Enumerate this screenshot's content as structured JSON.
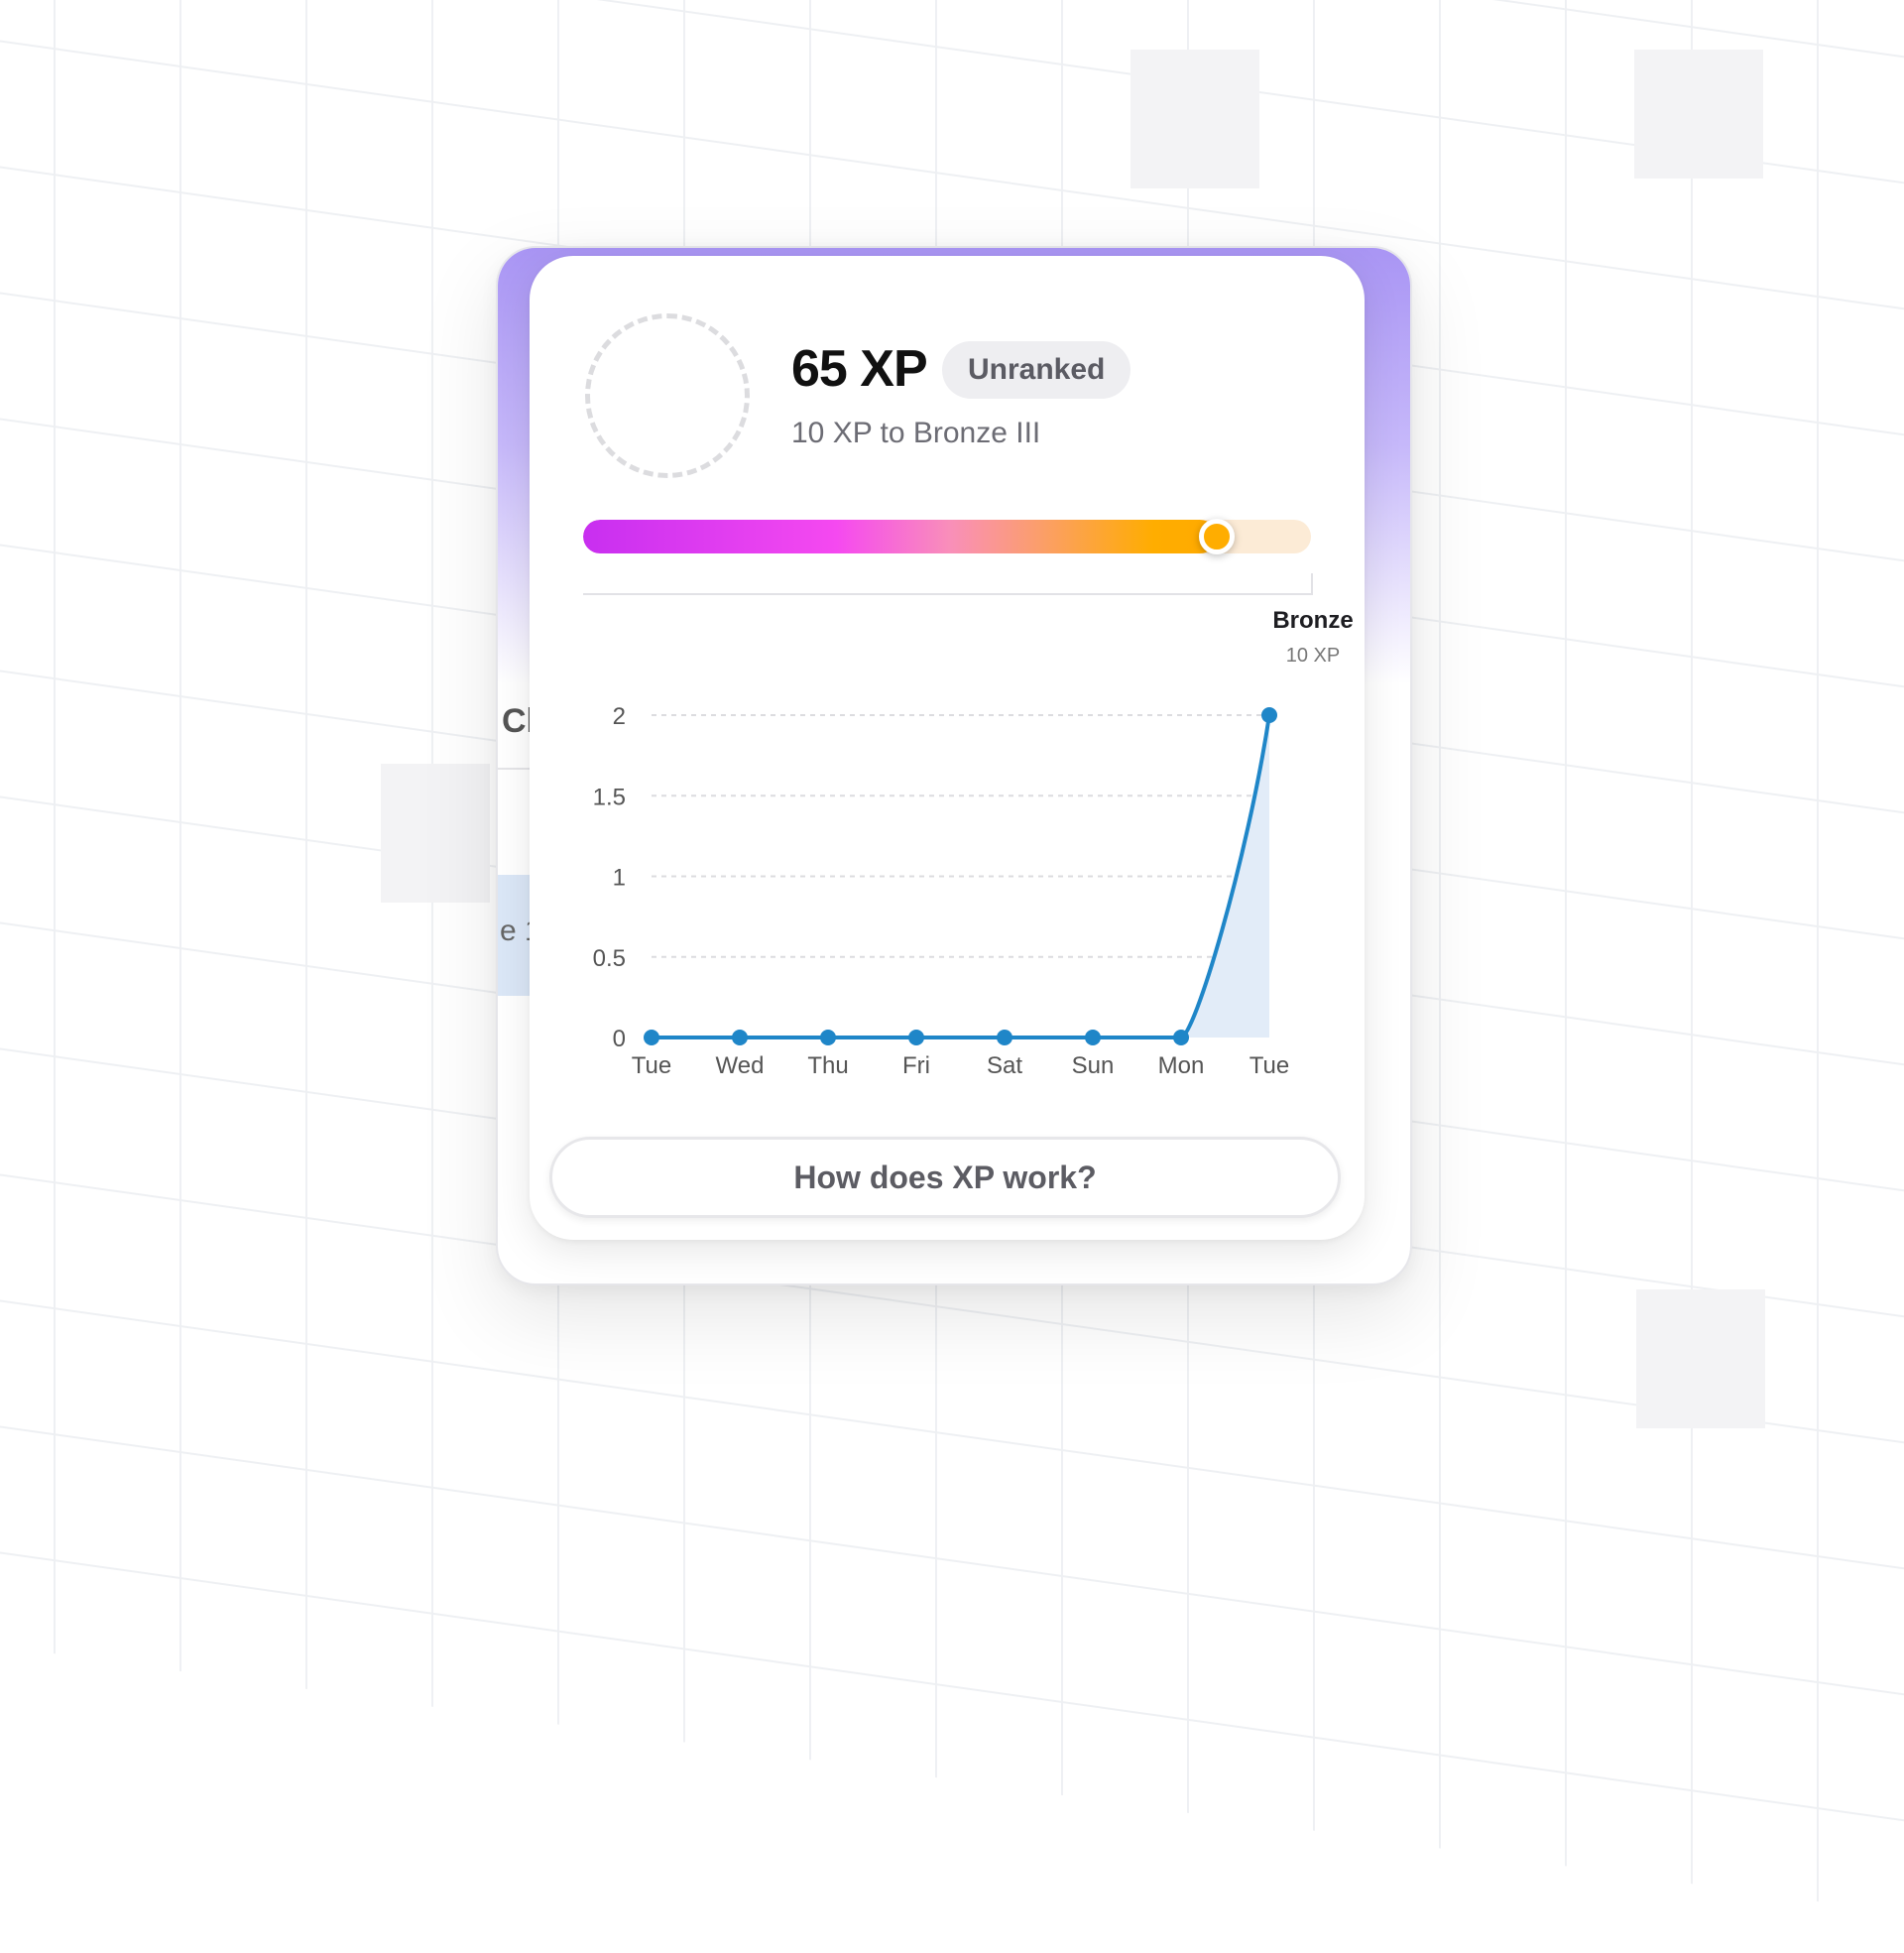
{
  "xp_card": {
    "xp_total": "65 XP",
    "rank_badge": "Unranked",
    "xp_to_next": "10 XP to Bronze III",
    "progress_fraction": 0.87,
    "milestone": {
      "name": "Bronze",
      "xp": "10 XP"
    },
    "help_button_label": "How does XP work?"
  },
  "background_panel": {
    "peek_heading": "Cl",
    "peek_text": "e 1"
  },
  "colors": {
    "accent_purple": "#a995f4",
    "line": "#1f86c8",
    "area": "#e2ecf8",
    "knob": "#ffad00"
  },
  "chart_data": {
    "type": "area",
    "categories": [
      "Tue",
      "Wed",
      "Thu",
      "Fri",
      "Sat",
      "Sun",
      "Mon",
      "Tue"
    ],
    "series": [
      {
        "values": [
          0,
          0,
          0,
          0,
          0,
          0,
          0,
          2
        ]
      }
    ],
    "y_ticks": [
      "0",
      "0.5",
      "1",
      "1.5",
      "2"
    ],
    "ylim": [
      0,
      2
    ],
    "grid": true,
    "title": "",
    "xlabel": "",
    "ylabel": ""
  }
}
